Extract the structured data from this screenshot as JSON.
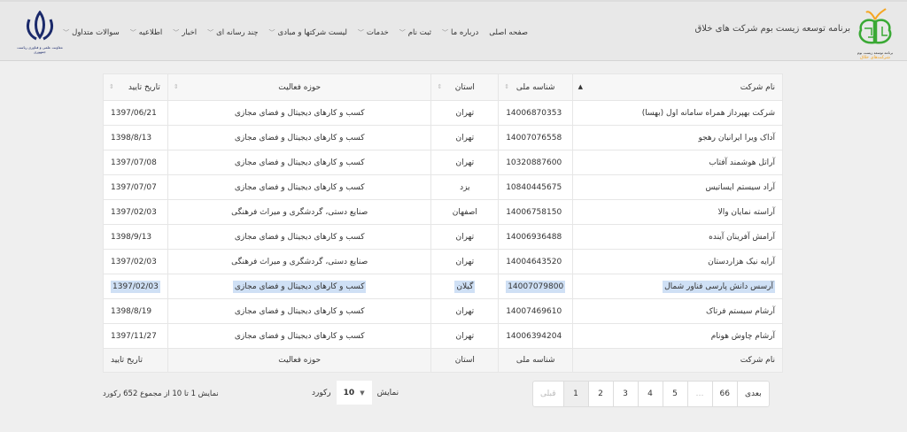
{
  "header": {
    "brand_title": "برنامه توسعه زیست بوم شرکت های خلاق",
    "logo_text_top": "برنامه توسعه زیست بوم",
    "logo_text_bottom": "شرکت‌های خلاق",
    "emblem_caption": "معاونت علمی و فناوری ریاست جمهوری"
  },
  "menu": [
    {
      "label": "صفحه اصلی",
      "dropdown": false
    },
    {
      "label": "درباره ما",
      "dropdown": true
    },
    {
      "label": "ثبت نام",
      "dropdown": true
    },
    {
      "label": "خدمات",
      "dropdown": true
    },
    {
      "label": "لیست شرکتها و مبادی",
      "dropdown": true
    },
    {
      "label": "چند رسانه ای",
      "dropdown": true
    },
    {
      "label": "اخبار",
      "dropdown": true
    },
    {
      "label": "اطلاعیه",
      "dropdown": true
    },
    {
      "label": "سوالات متداول",
      "dropdown": true
    }
  ],
  "table": {
    "columns": [
      "نام شرکت",
      "شناسه ملی",
      "استان",
      "حوزه فعالیت",
      "تاریخ تایید"
    ],
    "rows": [
      [
        "شرکت بهپرداز همراه سامانه اول (بهسا)",
        "14006870353",
        "تهران",
        "کسب و کارهای دیجیتال و فضای مجازی",
        "1397/06/21"
      ],
      [
        "آداک ویرا ایرانیان رهجو",
        "14007076558",
        "تهران",
        "کسب و کارهای دیجیتال و فضای مجازی",
        "1398/8/13"
      ],
      [
        "آراتل هوشمند آفتاب",
        "10320887600",
        "تهران",
        "کسب و کارهای دیجیتال و فضای مجازی",
        "1397/07/08"
      ],
      [
        "آراد سیستم ایساتیس",
        "10840445675",
        "یزد",
        "کسب و کارهای دیجیتال و فضای مجازی",
        "1397/07/07"
      ],
      [
        "آراسته نمایان والا",
        "14006758150",
        "اصفهان",
        "صنایع دستی، گردشگری و میراث فرهنگی",
        "1397/02/03"
      ],
      [
        "آرامش آفرینان آینده",
        "14006936488",
        "تهران",
        "کسب و کارهای دیجیتال و فضای مجازی",
        "1398/9/13"
      ],
      [
        "آرایه نیک هزاردستان",
        "14004643520",
        "تهران",
        "صنایع دستی، گردشگری و میراث فرهنگی",
        "1397/02/03"
      ],
      [
        "آرسس دانش پارسی فناور شمال",
        "14007079800",
        "گیلان",
        "کسب و کارهای دیجیتال و فضای مجازی",
        "1397/02/03"
      ],
      [
        "آرشام سیستم فرتاک",
        "14007469610",
        "تهران",
        "کسب و کارهای دیجیتال و فضای مجازی",
        "1398/8/19"
      ],
      [
        "آرشام چاوش هونام",
        "14006394204",
        "تهران",
        "کسب و کارهای دیجیتال و فضای مجازی",
        "1397/11/27"
      ]
    ],
    "selected_row": 7
  },
  "pagination": {
    "next": "بعدی",
    "pages": [
      "66",
      "…",
      "5",
      "4",
      "3",
      "2",
      "1"
    ],
    "current": "1",
    "prev": "قبلی"
  },
  "length": {
    "label_before": "نمایش",
    "value": "10",
    "label_after": "رکورد"
  },
  "info": "نمایش 1 تا 10 از مجموع 652 رکورد",
  "colors": {
    "selection": "#cfe0f5",
    "logo_green": "#3aa935",
    "logo_orange": "#f5a623"
  }
}
